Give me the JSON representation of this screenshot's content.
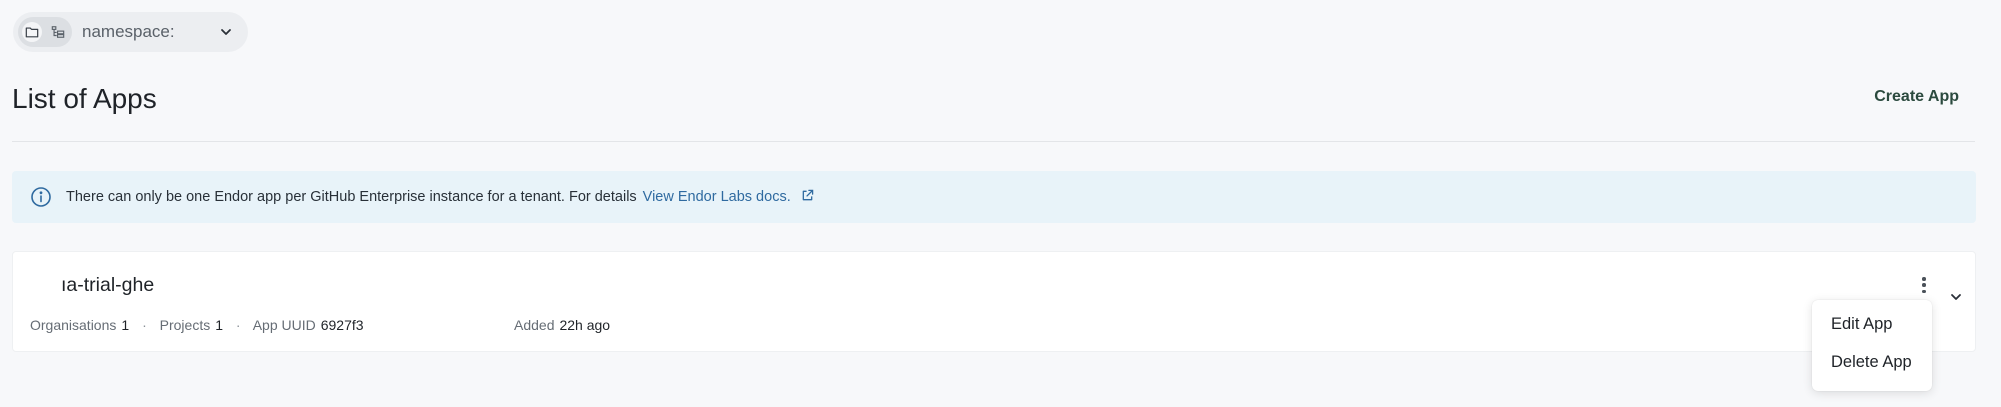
{
  "namespace_selector": {
    "label": "namespace:",
    "icons": {
      "left": "folder-icon",
      "right": "tree-list-icon",
      "expand": "chevron-down-icon"
    }
  },
  "header": {
    "title": "List of Apps",
    "create_label": "Create App"
  },
  "banner": {
    "text": "There can only be one Endor app per GitHub Enterprise instance for a tenant. For details",
    "link_text": "View Endor Labs docs.",
    "icon": "info-icon",
    "link_icon": "external-link-icon"
  },
  "app": {
    "name": "ıa-trial-ghe",
    "organisations_label": "Organisations",
    "organisations_value": "1",
    "projects_label": "Projects",
    "projects_value": "1",
    "uuid_label": "App UUID",
    "uuid_value": "6927f3",
    "added_label": "Added",
    "added_value": "22h ago",
    "separator": "·"
  },
  "menu": {
    "items": [
      {
        "label": "Edit App"
      },
      {
        "label": "Delete App"
      }
    ]
  },
  "colors": {
    "background": "#f7f8fa",
    "banner_bg": "#e8f3f9",
    "link": "#2f6aa0",
    "create_button": "#2b4a3e"
  }
}
